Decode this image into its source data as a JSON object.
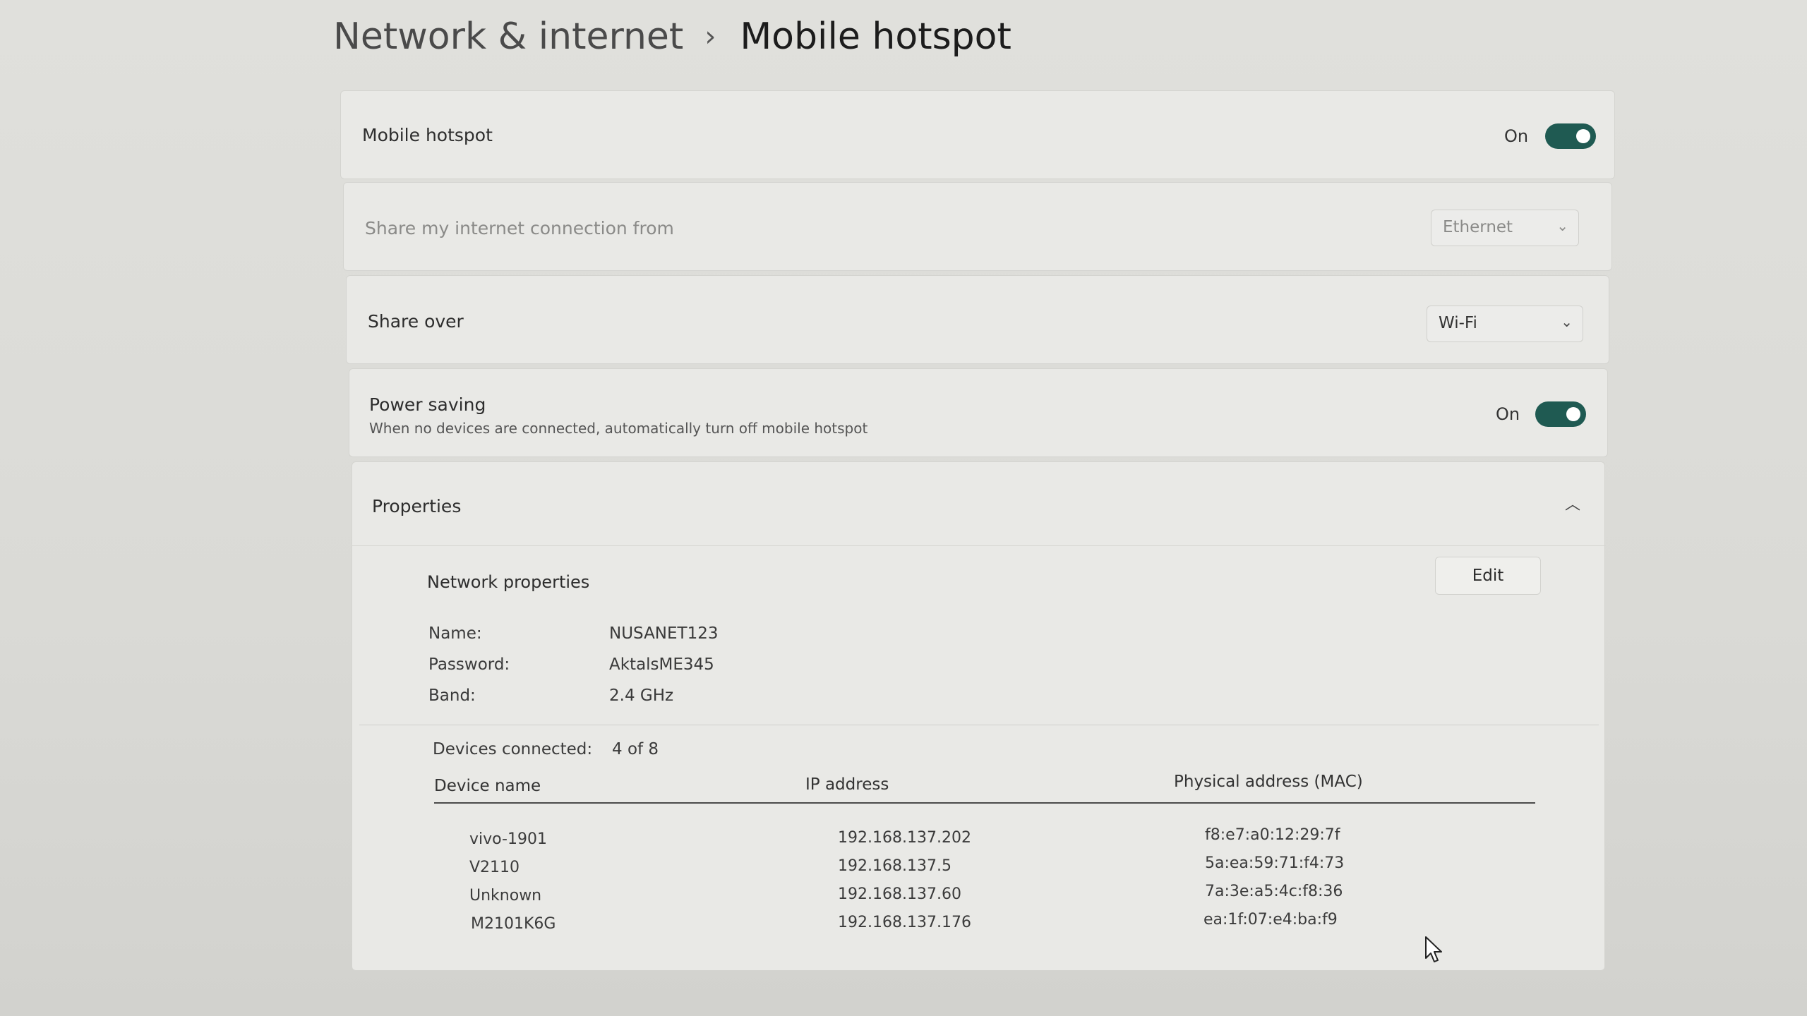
{
  "breadcrumb": {
    "parent": "Network & internet",
    "separator": "›",
    "current": "Mobile hotspot"
  },
  "mobile_hotspot": {
    "label": "Mobile hotspot",
    "state_text": "On",
    "enabled": true
  },
  "share_from": {
    "label": "Share my internet connection from",
    "value": "Ethernet",
    "disabled": true
  },
  "share_over": {
    "label": "Share over",
    "value": "Wi-Fi"
  },
  "power_saving": {
    "label": "Power saving",
    "description": "When no devices are connected, automatically turn off mobile hotspot",
    "state_text": "On",
    "enabled": true
  },
  "properties": {
    "label": "Properties",
    "expanded": true,
    "network_properties_label": "Network properties",
    "edit_label": "Edit",
    "fields": [
      {
        "key": "Name:",
        "value": "NUSANET123"
      },
      {
        "key": "Password:",
        "value": "AktalsME345"
      },
      {
        "key": "Band:",
        "value": "2.4 GHz"
      }
    ],
    "devices_connected_label": "Devices connected:",
    "devices_connected_value": "4 of 8",
    "table": {
      "headers": [
        "Device name",
        "IP address",
        "Physical address (MAC)"
      ],
      "rows": [
        [
          "vivo-1901",
          "192.168.137.202",
          "f8:e7:a0:12:29:7f"
        ],
        [
          "V2110",
          "192.168.137.5",
          "5a:ea:59:71:f4:73"
        ],
        [
          "Unknown",
          "192.168.137.60",
          "7a:3e:a5:4c:f8:36"
        ],
        [
          "M2101K6G",
          "192.168.137.176",
          "ea:1f:07:e4:ba:f9"
        ]
      ]
    }
  },
  "colors": {
    "toggle_on": "#1f5a52",
    "card_bg": "#e9e9e6",
    "page_bg": "#dcdcd8"
  },
  "icons": {
    "breadcrumb_separator": "chevron-right-icon",
    "dropdown": "chevron-down-icon",
    "collapse": "chevron-up-icon",
    "cursor": "mouse-pointer-icon"
  }
}
